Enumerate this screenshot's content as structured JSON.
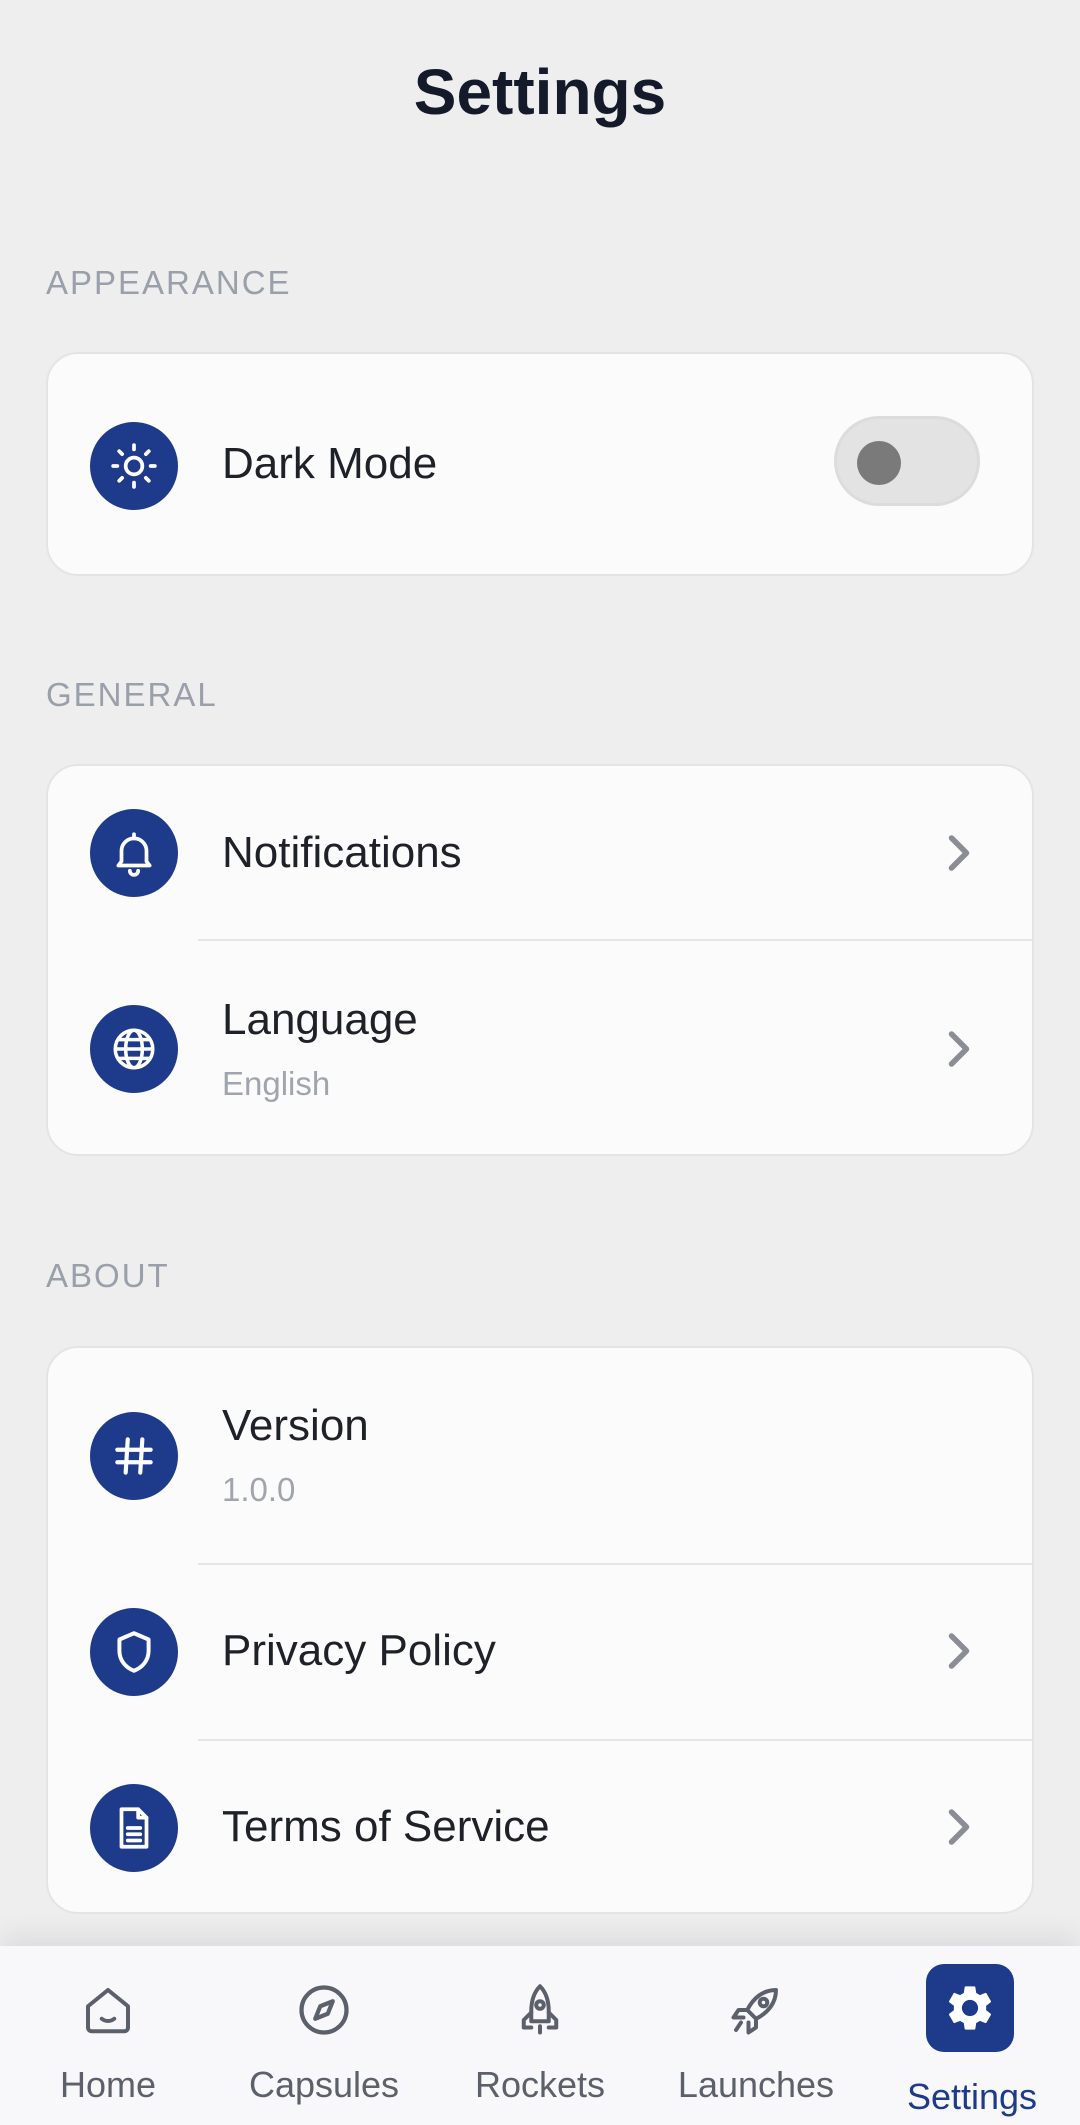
{
  "page": {
    "title": "Settings"
  },
  "sections": {
    "appearance": {
      "label": "APPEARANCE",
      "dark_mode": {
        "label": "Dark Mode",
        "icon": "sun-icon",
        "toggle_on": false
      }
    },
    "general": {
      "label": "GENERAL",
      "notifications": {
        "label": "Notifications",
        "icon": "bell-icon"
      },
      "language": {
        "label": "Language",
        "value": "English",
        "icon": "globe-icon"
      }
    },
    "about": {
      "label": "ABOUT",
      "version": {
        "label": "Version",
        "value": "1.0.0",
        "icon": "hash-icon"
      },
      "privacy": {
        "label": "Privacy Policy",
        "icon": "shield-icon"
      },
      "terms": {
        "label": "Terms of Service",
        "icon": "document-icon"
      }
    }
  },
  "bottom_nav": {
    "items": [
      {
        "label": "Home",
        "icon": "home-icon",
        "active": false
      },
      {
        "label": "Capsules",
        "icon": "compass-icon",
        "active": false
      },
      {
        "label": "Rockets",
        "icon": "rocket-icon",
        "active": false
      },
      {
        "label": "Launches",
        "icon": "launch-icon",
        "active": false
      },
      {
        "label": "Settings",
        "icon": "gear-icon",
        "active": true
      }
    ]
  },
  "colors": {
    "accent": "#1e3a8a",
    "background": "#eeeeee",
    "card": "#fbfbfb",
    "section_label": "#9aa0aa"
  }
}
